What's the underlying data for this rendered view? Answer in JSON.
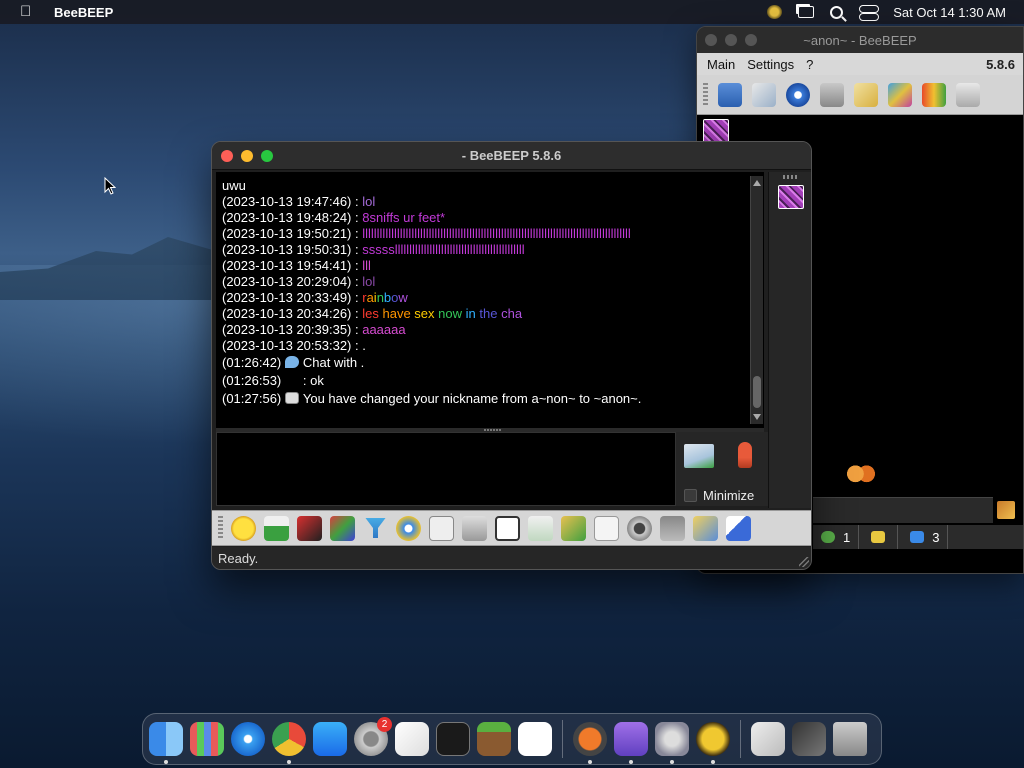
{
  "menubar": {
    "app_name": "BeeBEEP",
    "datetime": "Sat Oct 14  1:30 AM",
    "icons": [
      "apple-icon",
      "beebeep-tray-icon",
      "window-switch-icon",
      "search-icon",
      "control-center-icon"
    ]
  },
  "main_window": {
    "title": "~anon~ - BeeBEEP",
    "menu": [
      "Main",
      "Settings",
      "?"
    ],
    "version": "5.8.6",
    "status": {
      "groups_count": "1",
      "users_count": "",
      "network_count": "3"
    }
  },
  "chat_window": {
    "title": "- BeeBEEP 5.8.6",
    "messages": [
      {
        "ts": "",
        "sep": "",
        "text": "uwu",
        "color": "#ffffff"
      },
      {
        "ts": "(2023-10-13 19:47:46)",
        "sep": " : ",
        "text": "lol",
        "color": "#a46bd8"
      },
      {
        "ts": "(2023-10-13 19:48:24)",
        "sep": " : ",
        "text": "8sniffs ur feet*",
        "color": "#c23ad8"
      },
      {
        "ts": "(2023-10-13 19:50:21)",
        "sep": " : ",
        "text": "lllllllllllllllllllllllllllllllllllllllllllllllllllllllllllllllllllllllllllllllllllllllllllll",
        "color": "#c23ad8"
      },
      {
        "ts": "(2023-10-13 19:50:31)",
        "sep": " : ",
        "text": "ssssslllllllllllllllllllllllllllllllllllllllllllll",
        "color": "#c23ad8"
      },
      {
        "ts": "(2023-10-13 19:54:41)",
        "sep": " : ",
        "text": "lll",
        "color": "#d54cd0"
      },
      {
        "ts": "(2023-10-13 20:29:04)",
        "sep": " : ",
        "text": "lol",
        "color": "#8a4aa8"
      },
      {
        "ts": "(2023-10-13 20:33:49)",
        "sep": " : ",
        "text": "rainbow",
        "color": "rainbow"
      },
      {
        "ts": "(2023-10-13 20:34:26)",
        "sep": " : ",
        "text": "les have sex now in the cha",
        "color": "rainbow"
      },
      {
        "ts": "(2023-10-13 20:39:35)",
        "sep": " : ",
        "text": "aaaaaa",
        "color": "#d54cd0"
      },
      {
        "ts": "(2023-10-13 20:53:32)",
        "sep": " : ",
        "text": ".",
        "color": "#ffffff"
      }
    ],
    "system_messages": [
      {
        "ts": "(01:26:42)",
        "icon": "chat-bubble-icon",
        "text": "Chat with ."
      },
      {
        "ts": "(01:26:53)",
        "icon": "",
        "text": ": ok"
      },
      {
        "ts": "(01:27:56)",
        "icon": "keyboard-icon",
        "text": "You have changed your nickname from a~non~ to ~anon~."
      }
    ],
    "minimize_label": "Minimize",
    "status_text": "Ready.",
    "toolbar_icons": [
      "emoticon-icon",
      "email-icon",
      "font-icon",
      "color-icon",
      "filter-icon",
      "settings-icon",
      "spellcheck-icon",
      "compact-icon",
      "file-icon",
      "save-icon",
      "send-file-icon",
      "folder-icon",
      "html-icon",
      "screenshot-icon",
      "clear-icon",
      "notes-icon",
      "window-icon"
    ]
  },
  "dock": {
    "apps": [
      "finder",
      "launchpad",
      "safari",
      "chrome",
      "app-store",
      "system-settings",
      "textedit",
      "terminal",
      "minecraft",
      "chatgpt",
      "downloader",
      "disk-utility",
      "system-preferences",
      "beebeep",
      "downloads-stack",
      "recent-stack",
      "trash"
    ],
    "settings_badge": "2"
  },
  "colors": {
    "traffic_red": "#fe5f57",
    "traffic_yellow": "#febc2e",
    "traffic_green": "#28c840",
    "chat_background": "#000000"
  }
}
